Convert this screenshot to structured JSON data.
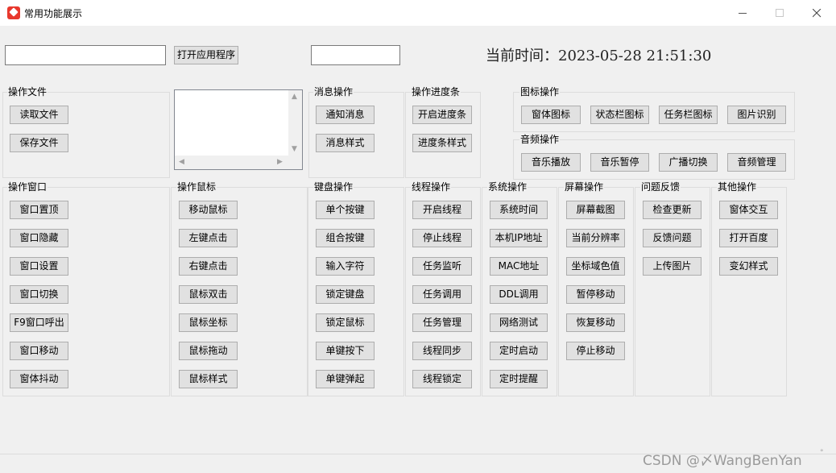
{
  "window": {
    "title": "常用功能展示"
  },
  "top": {
    "app_input_value": "",
    "open_app_button": "打开应用程序",
    "second_input_value": "",
    "time_label": "当前时间：",
    "time_value": "2023-05-28 21:51:30"
  },
  "groups": {
    "file": {
      "title": "操作文件",
      "buttons": [
        "读取文件",
        "保存文件"
      ]
    },
    "message": {
      "title": "消息操作",
      "buttons": [
        "通知消息",
        "消息样式"
      ]
    },
    "progress": {
      "title": "操作进度条",
      "buttons": [
        "开启进度条",
        "进度条样式"
      ]
    },
    "icon": {
      "title": "图标操作",
      "buttons": [
        "窗体图标",
        "状态栏图标",
        "任务栏图标",
        "图片识别"
      ]
    },
    "audio": {
      "title": "音频操作",
      "buttons": [
        "音乐播放",
        "音乐暂停",
        "广播切换",
        "音频管理"
      ]
    },
    "window": {
      "title": "操作窗口",
      "buttons": [
        "窗口置顶",
        "窗口隐藏",
        "窗口设置",
        "窗口切换",
        "F9窗口呼出",
        "窗口移动",
        "窗体抖动"
      ]
    },
    "mouse": {
      "title": "操作鼠标",
      "buttons": [
        "移动鼠标",
        "左键点击",
        "右键点击",
        "鼠标双击",
        "鼠标坐标",
        "鼠标拖动",
        "鼠标样式"
      ]
    },
    "keyboard": {
      "title": "键盘操作",
      "buttons": [
        "单个按键",
        "组合按键",
        "输入字符",
        "锁定键盘",
        "锁定鼠标",
        "单键按下",
        "单键弹起"
      ]
    },
    "thread": {
      "title": "线程操作",
      "buttons": [
        "开启线程",
        "停止线程",
        "任务监听",
        "任务调用",
        "任务管理",
        "线程同步",
        "线程锁定"
      ]
    },
    "system": {
      "title": "系统操作",
      "buttons": [
        "系统时间",
        "本机IP地址",
        "MAC地址",
        "DDL调用",
        "网络测试",
        "定时启动",
        "定时提醒"
      ]
    },
    "screen": {
      "title": "屏幕操作",
      "buttons": [
        "屏幕截图",
        "当前分辨率",
        "坐标域色值",
        "暂停移动",
        "恢复移动",
        "停止移动"
      ]
    },
    "feedback": {
      "title": "问题反馈",
      "buttons": [
        "检查更新",
        "反馈问题",
        "上传图片"
      ]
    },
    "other": {
      "title": "其他操作",
      "buttons": [
        "窗体交互",
        "打开百度",
        "变幻样式"
      ]
    }
  },
  "watermark": "CSDN @〆WangBenYan"
}
